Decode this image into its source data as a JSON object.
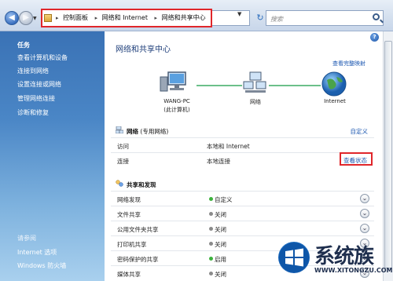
{
  "address": {
    "crumbs": [
      "控制面板",
      "网络和 Internet",
      "网络和共享中心"
    ],
    "search_placeholder": "搜索"
  },
  "sidebar": {
    "title": "任务",
    "items": [
      "查看计算机和设备",
      "连接到网络",
      "设置连接或网络",
      "管理网络连接",
      "诊断和修复"
    ],
    "see_also_title": "请参阅",
    "see_also": [
      "Internet 选项",
      "Windows 防火墙"
    ]
  },
  "main": {
    "title": "网络和共享中心",
    "view_full_map": "查看完整映射",
    "map": {
      "pc_name": "WANG-PC",
      "pc_sub": "(此计算机)",
      "network_label": "网络",
      "internet_label": "Internet"
    },
    "network_section": {
      "name": "网络",
      "type": "(专用网络)",
      "customize": "自定义",
      "rows": [
        {
          "key": "访问",
          "value": "本地和 Internet"
        },
        {
          "key": "连接",
          "value": "本地连接"
        }
      ],
      "view_status": "查看状态"
    },
    "sharing_section": {
      "title": "共享和发现",
      "rows": [
        {
          "key": "网络发现",
          "value": "自定义",
          "state": "on"
        },
        {
          "key": "文件共享",
          "value": "关闭",
          "state": "off"
        },
        {
          "key": "公用文件夹共享",
          "value": "关闭",
          "state": "off"
        },
        {
          "key": "打印机共享",
          "value": "关闭",
          "state": "off"
        },
        {
          "key": "密码保护的共享",
          "value": "启用",
          "state": "on"
        },
        {
          "key": "媒体共享",
          "value": "关闭",
          "state": "off"
        }
      ]
    }
  },
  "watermark": {
    "brand": "系统族",
    "url": "WWW.XITONGZU.COM"
  },
  "colors": {
    "on": "#3db23d",
    "off": "#8a8a8a",
    "highlight": "#e0262b",
    "link": "#1a56b0"
  }
}
